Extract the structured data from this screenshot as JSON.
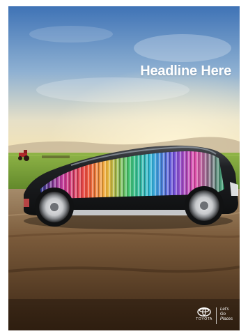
{
  "ad": {
    "headline": "Headline Here",
    "brand_name": "TOYOTA",
    "tagline_lines": [
      "Let's",
      "Go",
      "Places"
    ]
  },
  "icons": {
    "logo": "toyota-logo-icon"
  },
  "colors": {
    "sky_top": "#3f73b6",
    "sky_bottom": "#f4e3b5",
    "field": "#7fa53a",
    "road": "#6b4a2d",
    "car_body": "#1f2124",
    "brand_text": "#ffffff"
  }
}
